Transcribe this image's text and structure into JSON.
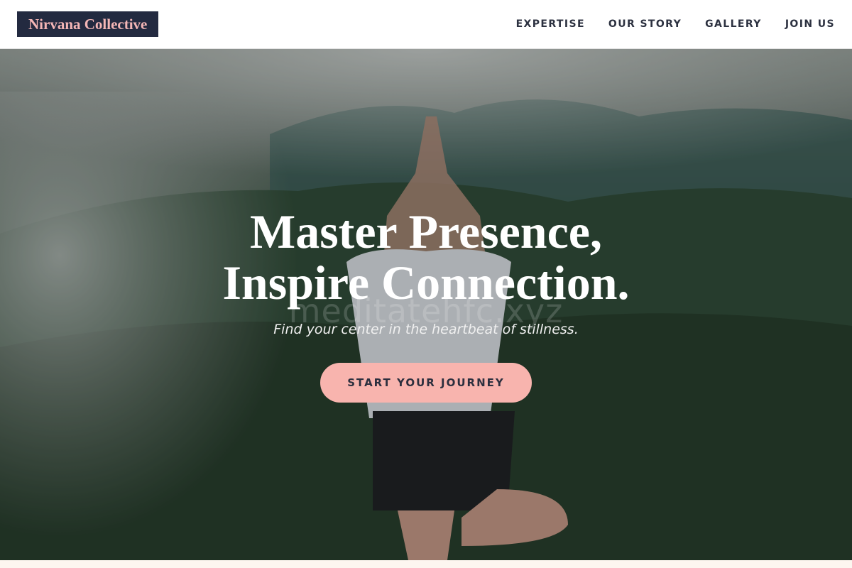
{
  "brand": {
    "name": "Nirvana Collective"
  },
  "nav": {
    "items": [
      {
        "label": "EXPERTISE"
      },
      {
        "label": "OUR STORY"
      },
      {
        "label": "GALLERY"
      },
      {
        "label": "JOIN US"
      }
    ]
  },
  "hero": {
    "headline_line1": "Master Presence,",
    "headline_line2": "Inspire Connection.",
    "watermark": "meditatehfc.xyz",
    "subtitle": "Find your center in the heartbeat of stillness.",
    "cta_label": "START YOUR JOURNEY"
  },
  "colors": {
    "brand_bg": "#232a40",
    "brand_text": "#f4b6b6",
    "cta_bg": "#f8b4ae",
    "nav_text": "#2c3140"
  }
}
